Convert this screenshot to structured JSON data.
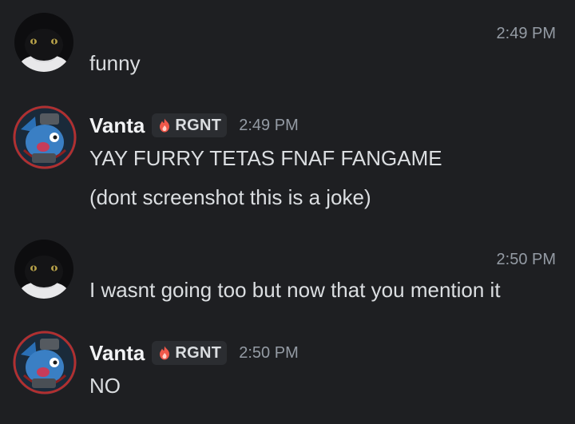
{
  "messages": [
    {
      "author": "",
      "timestamp": "2:49 PM",
      "lines": [
        "funny"
      ]
    },
    {
      "author": "Vanta",
      "tag": "RGNT",
      "tag_icon": "flame-icon",
      "timestamp": "2:49 PM",
      "lines": [
        "YAY FURRY TETAS FNAF FANGAME",
        "(dont screenshot this is a joke)"
      ]
    },
    {
      "author": "",
      "timestamp": "2:50 PM",
      "lines": [
        "I wasnt going too but now that you mention it"
      ]
    },
    {
      "author": "Vanta",
      "tag": "RGNT",
      "tag_icon": "flame-icon",
      "timestamp": "2:50 PM",
      "lines": [
        "NO"
      ]
    }
  ],
  "colors": {
    "background": "#1e1f22",
    "text": "#dbdee1",
    "muted": "#949ba4",
    "tag_bg": "#2b2d31",
    "flame": "#f0584a"
  }
}
